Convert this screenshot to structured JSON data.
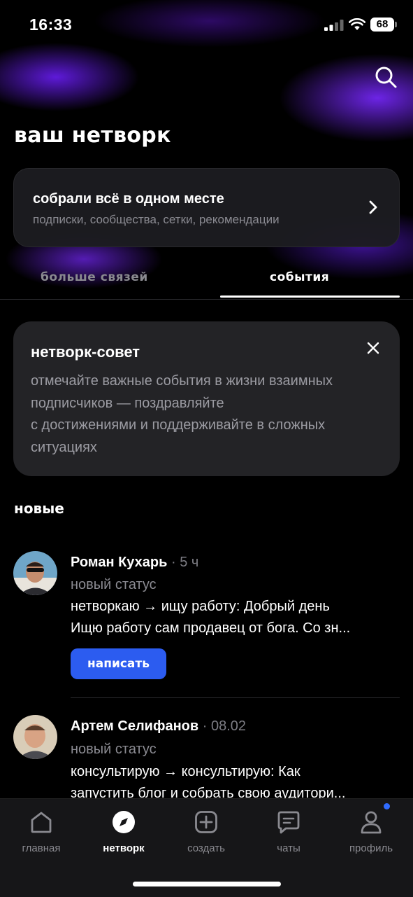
{
  "status_bar": {
    "time": "16:33",
    "battery": "68"
  },
  "header": {
    "title": "ваш нетворк"
  },
  "hub_card": {
    "title": "собрали всё в одном месте",
    "subtitle": "подписки, сообщества, сетки, рекомендации"
  },
  "tabs": [
    {
      "label": "больше связей",
      "active": false
    },
    {
      "label": "события",
      "active": true
    }
  ],
  "tip": {
    "title": "нетворк-совет",
    "lines": [
      "отмечайте важные события в жизни взаимных",
      "подписчиков — поздравляйте",
      "с достижениями и поддерживайте в сложных",
      "ситуациях"
    ]
  },
  "section_title": "новые",
  "feed": [
    {
      "name": "Роман Кухарь",
      "time": " · 5 ч",
      "status_label": "новый статус",
      "message_lines": [
        "нетворкаю → ищу работу: Добрый день",
        "Ищю работу сам продавец от бога. Со зн..."
      ],
      "button": "написать"
    },
    {
      "name": "Артем Селифанов",
      "time": " · 08.02",
      "status_label": "новый статус",
      "message_lines": [
        "консультирую → консультирую: Как",
        "запустить блог и собрать свою аудитори..."
      ]
    }
  ],
  "tabbar": [
    {
      "label": "главная",
      "icon": "home-icon",
      "active": false
    },
    {
      "label": "нетворк",
      "icon": "compass-icon",
      "active": true
    },
    {
      "label": "создать",
      "icon": "plus-square-icon",
      "active": false
    },
    {
      "label": "чаты",
      "icon": "chat-icon",
      "active": false
    },
    {
      "label": "профиль",
      "icon": "person-icon",
      "active": false,
      "has_notification": true
    }
  ],
  "colors": {
    "accent": "#2c5cf0",
    "glow": "#6e1eff",
    "background": "#000000"
  }
}
